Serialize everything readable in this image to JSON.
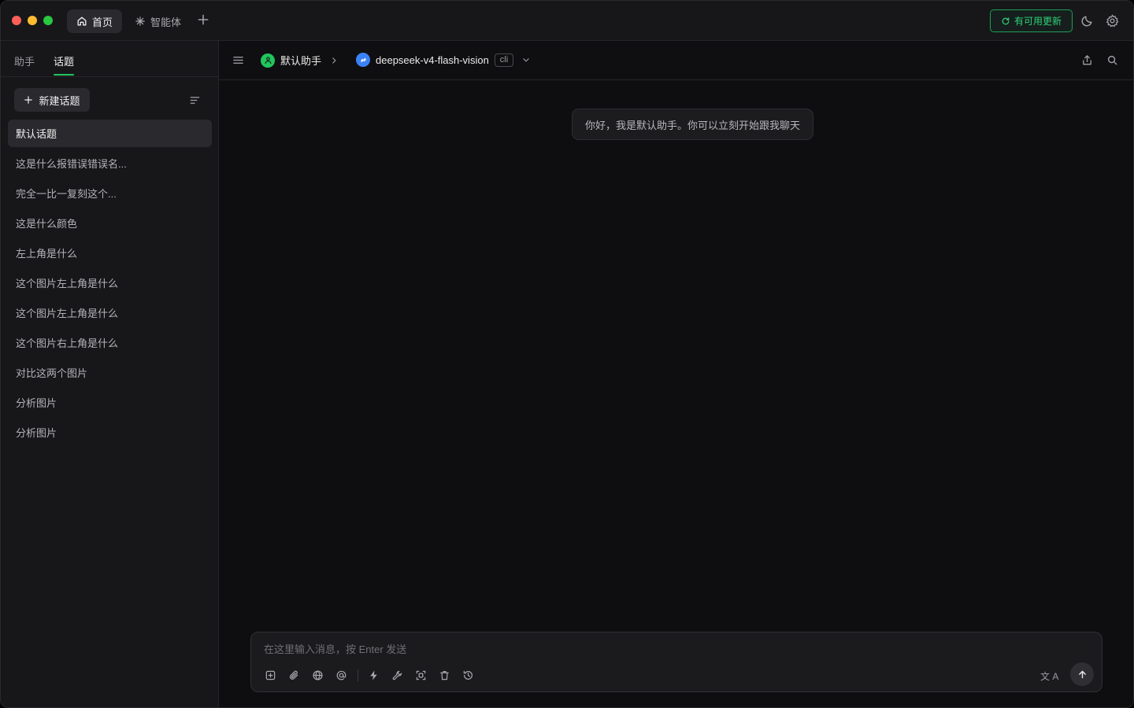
{
  "titlebar": {
    "tabs": [
      {
        "label": "首页",
        "icon": "home-icon",
        "active": true
      },
      {
        "label": "智能体",
        "icon": "sparkle-icon",
        "active": false
      }
    ],
    "update_label": "有可用更新",
    "accent_color": "#22c55e"
  },
  "sidebar": {
    "tabs": [
      {
        "label": "助手",
        "active": false
      },
      {
        "label": "话题",
        "active": true
      }
    ],
    "new_topic_label": "新建话题",
    "topics": [
      {
        "label": "默认话题",
        "active": true
      },
      {
        "label": "这是什么报错误错误名...",
        "active": false
      },
      {
        "label": "完全一比一复刻这个...",
        "active": false
      },
      {
        "label": "这是什么颜色",
        "active": false
      },
      {
        "label": "左上角是什么",
        "active": false
      },
      {
        "label": "这个图片左上角是什么",
        "active": false
      },
      {
        "label": "这个图片左上角是什么",
        "active": false
      },
      {
        "label": "这个图片右上角是什么",
        "active": false
      },
      {
        "label": "对比这两个图片",
        "active": false
      },
      {
        "label": "分析图片",
        "active": false
      },
      {
        "label": "分析图片",
        "active": false
      }
    ]
  },
  "main": {
    "assistant_name": "默认助手",
    "model_name": "deepseek-v4-flash-vision",
    "model_tag": "cli",
    "greeting": "你好，我是默认助手。你可以立刻开始跟我聊天"
  },
  "composer": {
    "placeholder": "在这里输入消息，按 Enter 发送",
    "value": "",
    "translate_label": "文 A"
  }
}
